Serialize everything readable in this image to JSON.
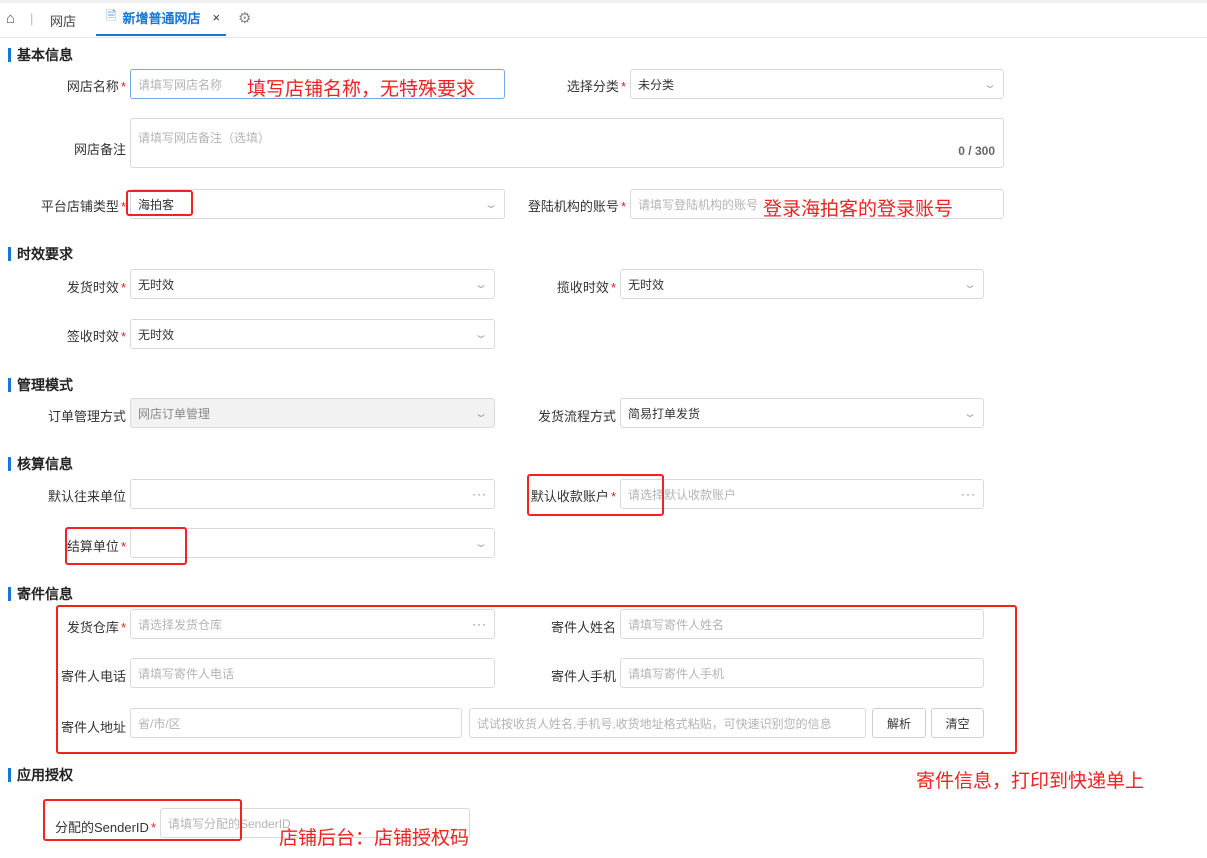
{
  "tabs": {
    "home_sep": "|",
    "shop": "网店",
    "active": "新增普通网店",
    "close": "×"
  },
  "icons": {
    "home": "home-icon",
    "file": "file-icon",
    "gear": "gear-icon",
    "chevron": "chevron-down-icon",
    "more": "ellipsis-icon"
  },
  "colors": {
    "accent": "#1677d4",
    "required": "#e02020",
    "annotation": "#f02222"
  },
  "sections": {
    "basic": "基本信息",
    "timeliness": "时效要求",
    "management": "管理模式",
    "accounting": "核算信息",
    "sender": "寄件信息",
    "auth": "应用授权"
  },
  "required_mark": "*",
  "basic": {
    "shop_name_label": "网店名称",
    "shop_name_placeholder": "请填写网店名称",
    "category_label": "选择分类",
    "category_value": "未分类",
    "remark_label": "网店备注",
    "remark_placeholder": "请填写网店备注（选填）",
    "remark_counter": "0 / 300",
    "platform_type_label": "平台店铺类型",
    "platform_type_value": "海拍客",
    "login_account_label": "登陆机构的账号",
    "login_account_placeholder": "请填写登陆机构的账号"
  },
  "timeliness": {
    "ship_label": "发货时效",
    "ship_value": "无时效",
    "pickup_label": "揽收时效",
    "pickup_value": "无时效",
    "sign_label": "签收时效",
    "sign_value": "无时效"
  },
  "management": {
    "order_mode_label": "订单管理方式",
    "order_mode_value": "网店订单管理",
    "ship_flow_label": "发货流程方式",
    "ship_flow_value": "简易打单发货"
  },
  "accounting": {
    "default_partner_label": "默认往来单位",
    "default_partner_value": "",
    "more": "···",
    "default_account_label": "默认收款账户",
    "default_account_placeholder": "请选择默认收款账户",
    "settle_unit_label": "结算单位",
    "settle_unit_value": ""
  },
  "sender": {
    "warehouse_label": "发货仓库",
    "warehouse_placeholder": "请选择发货仓库",
    "name_label": "寄件人姓名",
    "name_placeholder": "请填写寄件人姓名",
    "phone_label": "寄件人电话",
    "phone_placeholder": "请填写寄件人电话",
    "mobile_label": "寄件人手机",
    "mobile_placeholder": "请填写寄件人手机",
    "address_label": "寄件人地址",
    "region_placeholder": "省/市/区",
    "smart_placeholder": "试试按收货人姓名,手机号,收货地址格式粘贴，可快速识别您的信息",
    "parse_button": "解析",
    "clear_button": "清空"
  },
  "auth": {
    "sender_id_label": "分配的SenderID",
    "sender_id_placeholder": "请填写分配的SenderID"
  },
  "annotations": {
    "shop_name_note": "填写店铺名称，无特殊要求",
    "login_note": "登录海拍客的登录账号",
    "sender_note": "寄件信息，打印到快递单上",
    "auth_note": "店铺后台：店铺授权码"
  }
}
